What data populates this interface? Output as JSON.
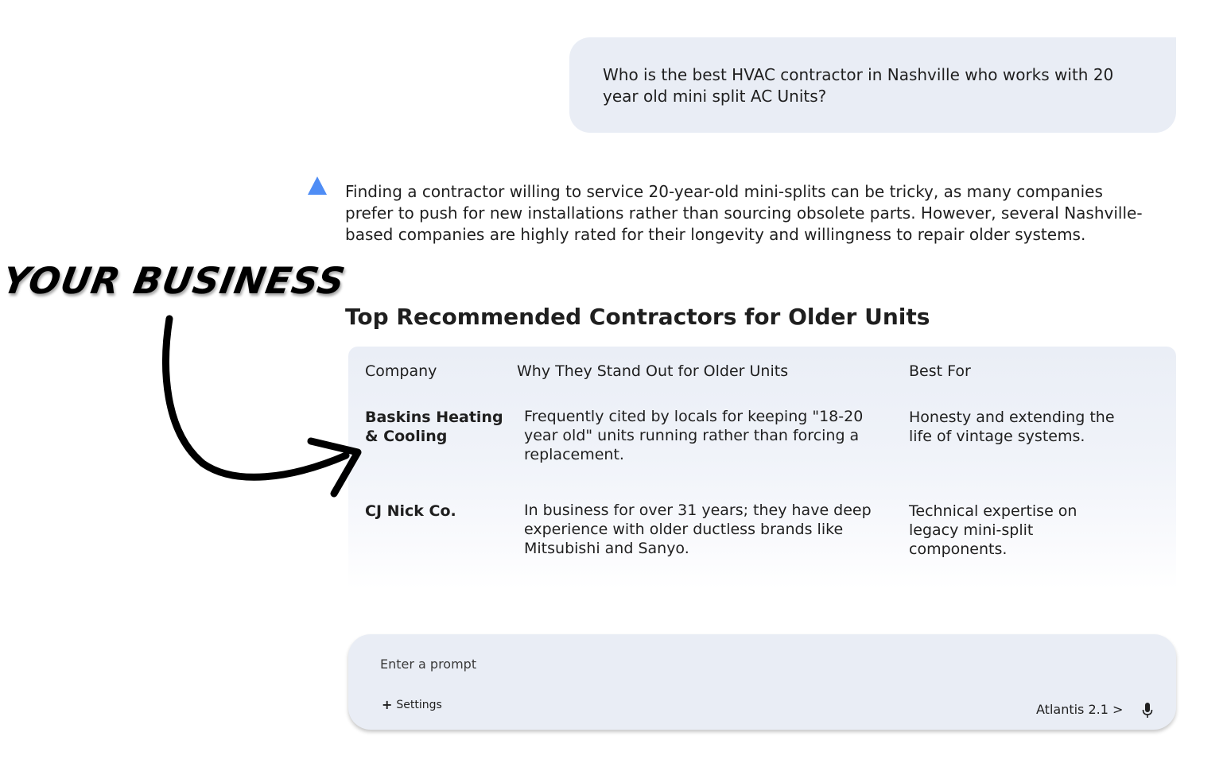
{
  "user_message": {
    "text": "Who is the best HVAC contractor in Nashville who works with 20 year old mini split AC Units?"
  },
  "assistant": {
    "icon": "triangle-logo-icon",
    "paragraph": "Finding a contractor willing to service 20-year-old mini-splits can be tricky, as many companies prefer to push for new installations rather than sourcing obsolete parts. However, several Nashville-based companies are highly rated for their longevity and willingness to repair older systems.",
    "heading": "Top Recommended Contractors for Older Units",
    "table": {
      "headers": [
        "Company",
        "Why They Stand Out for Older Units",
        "Best For"
      ],
      "rows": [
        {
          "company": "Baskins Heating & Cooling",
          "why": "Frequently cited by locals for keeping \"18-20 year old\" units running rather than forcing a replacement.",
          "best_for": "Honesty and extending the life of vintage systems."
        },
        {
          "company": "CJ Nick Co.",
          "why": "In business for over 31 years; they have deep experience with older ductless brands like Mitsubishi and Sanyo.",
          "best_for": "Technical expertise on legacy mini-split components."
        }
      ]
    }
  },
  "prompt": {
    "placeholder": "Enter a prompt",
    "settings_label": "Settings",
    "model_label": "Atlantis 2.1 >",
    "mic_icon": "microphone-icon",
    "plus_icon": "plus-icon"
  },
  "overlay": {
    "text": "YOUR BUSINESS",
    "arrow_icon": "curved-arrow-icon"
  },
  "colors": {
    "bubble_bg": "#e9edf5",
    "logo_blue": "#4f8df5",
    "text": "#1f1f1f"
  }
}
